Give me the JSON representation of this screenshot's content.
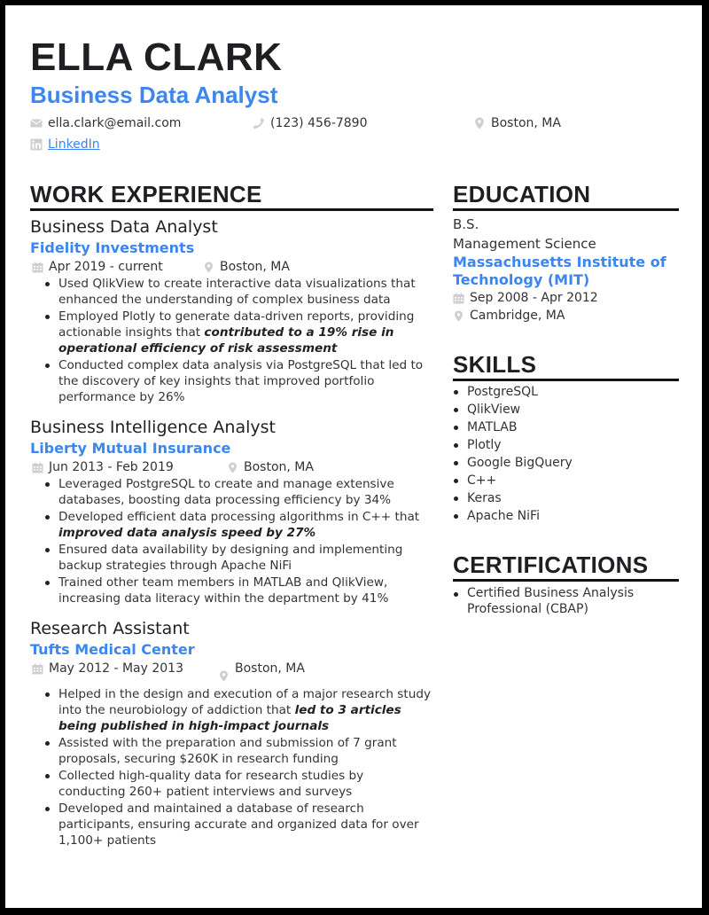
{
  "header": {
    "name": "ELLA CLARK",
    "title": "Business Data Analyst",
    "contact": {
      "email": "ella.clark@email.com",
      "phone": "(123) 456-7890",
      "location": "Boston, MA",
      "linkedin_label": "LinkedIn"
    }
  },
  "icons": {
    "email": "envelope-icon",
    "phone": "phone-icon",
    "location": "map-pin-icon",
    "linkedin": "linkedin-icon",
    "calendar": "calendar-icon"
  },
  "colors": {
    "accent": "#3b86f0",
    "heading": "#1d1f22",
    "icon": "#c8c8c8"
  },
  "work": {
    "heading": "WORK EXPERIENCE",
    "jobs": [
      {
        "title": "Business Data Analyst",
        "company": "Fidelity Investments",
        "dates": "Apr 2019 - current",
        "location": "Boston, MA",
        "bullets": [
          {
            "text": "Used QlikView to create interactive data visualizations that enhanced the understanding of complex business data",
            "highlight": ""
          },
          {
            "text": "Employed Plotly to generate data-driven reports, providing actionable insights that ",
            "highlight": "contributed to a 19% rise in operational efficiency of risk assessment"
          },
          {
            "text": "Conducted complex data analysis via PostgreSQL that led to the discovery of key insights that improved portfolio performance by 26%",
            "highlight": ""
          }
        ]
      },
      {
        "title": "Business Intelligence Analyst",
        "company": "Liberty Mutual Insurance",
        "dates": "Jun 2013 - Feb 2019",
        "location": "Boston, MA",
        "bullets": [
          {
            "text": "Leveraged PostgreSQL to create and manage extensive databases, boosting data processing efficiency by 34%",
            "highlight": ""
          },
          {
            "text": "Developed efficient data processing algorithms in C++ that ",
            "highlight": "improved data analysis speed by 27%"
          },
          {
            "text": "Ensured data availability by designing and implementing backup strategies through Apache NiFi",
            "highlight": ""
          },
          {
            "text": "Trained other team members in MATLAB and QlikView, increasing data literacy within the department by 41%",
            "highlight": ""
          }
        ]
      },
      {
        "title": "Research Assistant",
        "company": "Tufts Medical Center",
        "dates": "May 2012 - May 2013",
        "location": "Boston, MA",
        "bullets": [
          {
            "text": "Helped in the design and execution of a major research study into the neurobiology of addiction that ",
            "highlight": "led to 3 articles being published in high-impact journals"
          },
          {
            "text": "Assisted with the preparation and submission of 7 grant proposals, securing $260K in research funding",
            "highlight": ""
          },
          {
            "text": "Collected high-quality data for research studies by conducting 260+ patient interviews and surveys",
            "highlight": ""
          },
          {
            "text": "Developed and maintained a database of research participants, ensuring accurate and organized data for over 1,100+ patients",
            "highlight": ""
          }
        ]
      }
    ]
  },
  "education": {
    "heading": "EDUCATION",
    "degree": "B.S.",
    "field": "Management Science",
    "school": "Massachusetts Institute of Technology (MIT)",
    "dates": "Sep 2008 - Apr 2012",
    "location": "Cambridge, MA"
  },
  "skills": {
    "heading": "SKILLS",
    "items": [
      "PostgreSQL",
      "QlikView",
      "MATLAB",
      "Plotly",
      "Google BigQuery",
      "C++",
      "Keras",
      "Apache NiFi"
    ]
  },
  "certifications": {
    "heading": "CERTIFICATIONS",
    "items": [
      "Certified Business Analysis Professional (CBAP)"
    ]
  }
}
